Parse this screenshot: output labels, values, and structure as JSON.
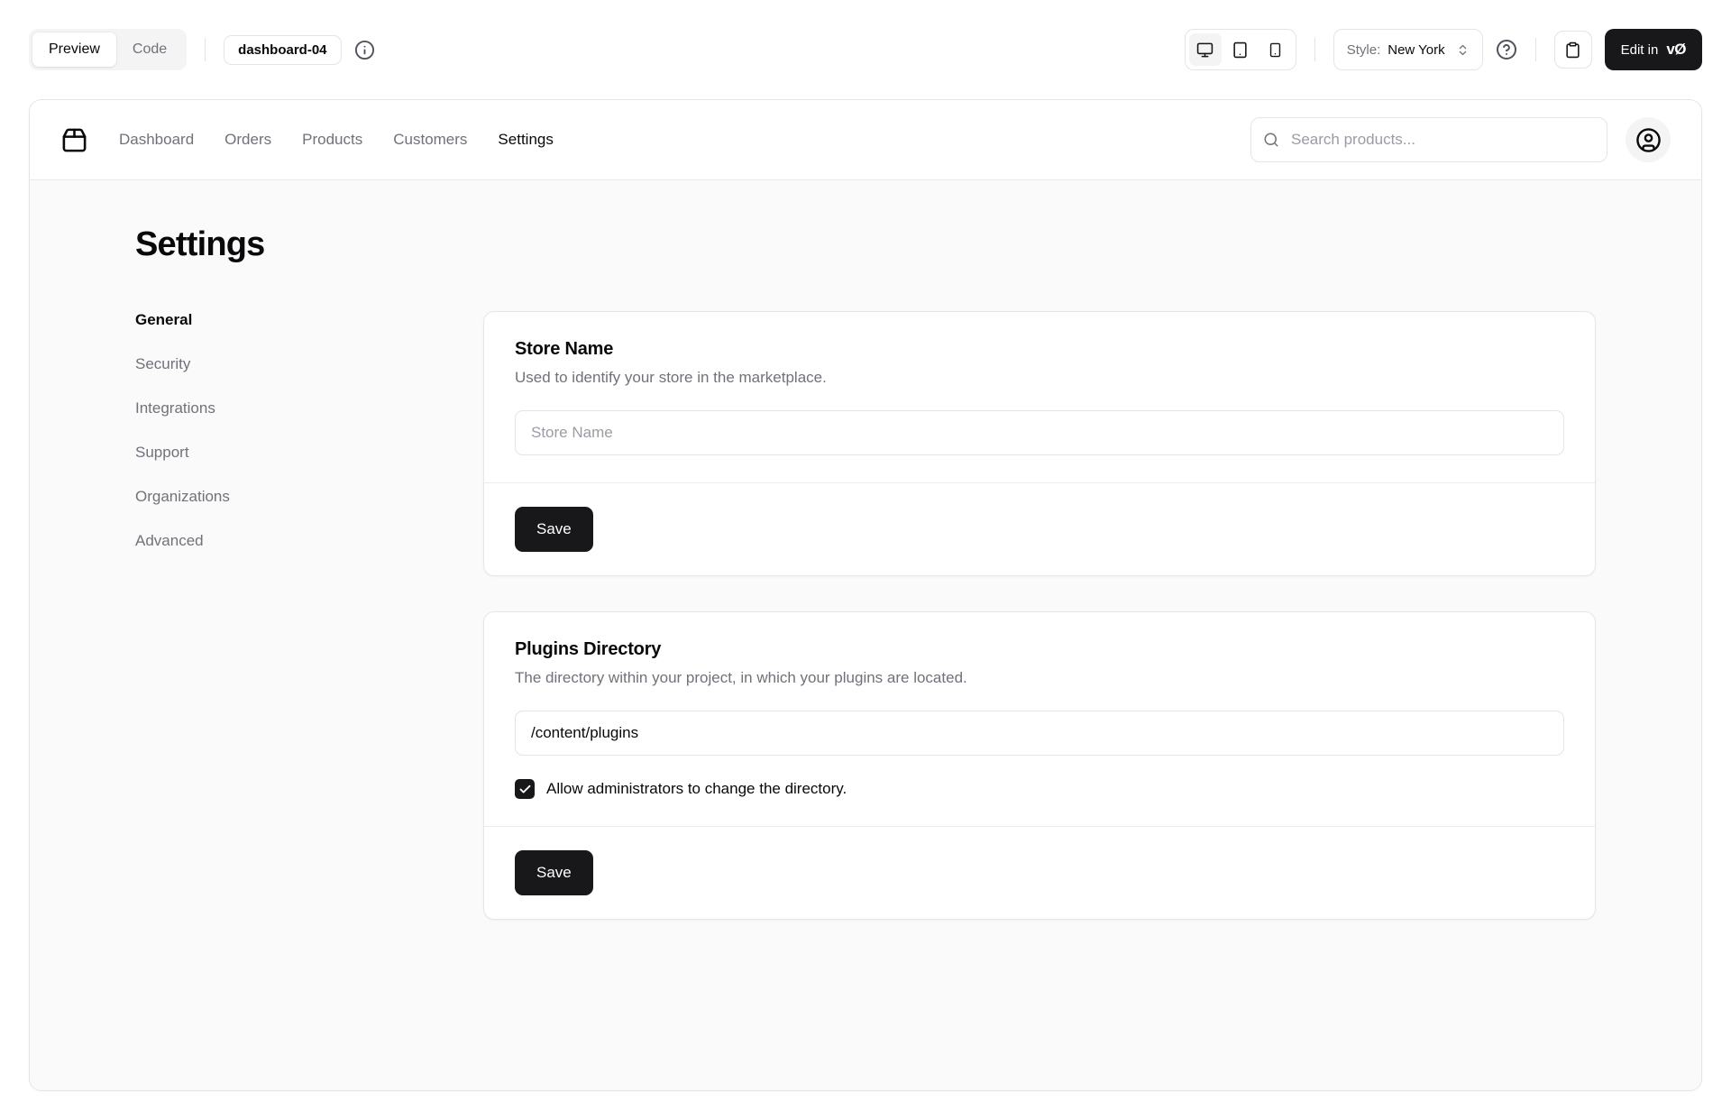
{
  "toolbar": {
    "tabs": [
      {
        "label": "Preview",
        "active": true
      },
      {
        "label": "Code",
        "active": false
      }
    ],
    "block_badge": "dashboard-04",
    "style_label": "Style:",
    "style_value": "New York",
    "edit_button_prefix": "Edit in",
    "edit_button_logo": "vØ",
    "icons": [
      "info-icon",
      "monitor-icon",
      "tablet-icon",
      "smartphone-icon",
      "chevrons-up-down-icon",
      "circle-help-icon",
      "clipboard-icon"
    ]
  },
  "navbar": {
    "brand_icon": "package-icon",
    "links": [
      {
        "label": "Dashboard",
        "active": false
      },
      {
        "label": "Orders",
        "active": false
      },
      {
        "label": "Products",
        "active": false
      },
      {
        "label": "Customers",
        "active": false
      },
      {
        "label": "Settings",
        "active": true
      }
    ],
    "search_placeholder": "Search products...",
    "avatar_icon": "circle-user-icon"
  },
  "page": {
    "title": "Settings",
    "sidebar": [
      {
        "label": "General",
        "active": true
      },
      {
        "label": "Security",
        "active": false
      },
      {
        "label": "Integrations",
        "active": false
      },
      {
        "label": "Support",
        "active": false
      },
      {
        "label": "Organizations",
        "active": false
      },
      {
        "label": "Advanced",
        "active": false
      }
    ],
    "cards": [
      {
        "title": "Store Name",
        "description": "Used to identify your store in the marketplace.",
        "input_placeholder": "Store Name",
        "input_value": "",
        "save_label": "Save"
      },
      {
        "title": "Plugins Directory",
        "description": "The directory within your project, in which your plugins are located.",
        "input_value": "/content/plugins",
        "checkbox_label": "Allow administrators to change the directory.",
        "checkbox_checked": true,
        "save_label": "Save"
      }
    ]
  },
  "colors": {
    "accent_dark": "#18181b",
    "border": "#e4e4e7",
    "muted_bg": "#fafafa",
    "muted_text": "#71717a"
  }
}
